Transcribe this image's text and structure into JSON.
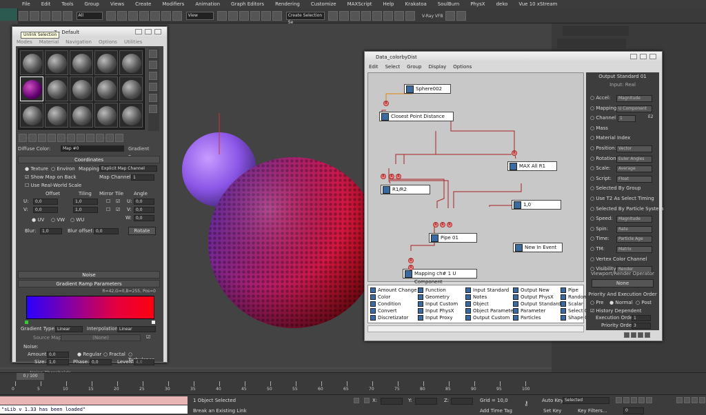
{
  "menubar": [
    "File",
    "Edit",
    "Tools",
    "Group",
    "Views",
    "Create",
    "Modifiers",
    "Animation",
    "Graph Editors",
    "Rendering",
    "Customize",
    "MAXScript",
    "Help",
    "Krakatoa",
    "SoulBurn",
    "PhysX",
    "deko",
    "Vue 10 xStream"
  ],
  "toolbar": {
    "filter": "All",
    "view": "View",
    "selection_set": "Create Selection Se",
    "vray_label": "V-Ray VFB"
  },
  "tooltip": "Unlink Selection",
  "material_editor": {
    "title": "7 - Default",
    "menu": [
      "Modes",
      "Material",
      "Navigation",
      "Options",
      "Utilities"
    ],
    "diffuse_label": "Diffuse Color:",
    "map_name": "Map #0",
    "map_type": "Gradient Ramp",
    "coordinates": {
      "title": "Coordinates",
      "texture": "Texture",
      "environ": "Environ",
      "mapping_label": "Mapping:",
      "mapping": "Explicit Map Channel",
      "show_map": "Show Map on Back",
      "map_channel_label": "Map Channel:",
      "map_channel": "1",
      "real_world": "Use Real-World Scale",
      "offset": "Offset",
      "tiling": "Tiling",
      "mirror_tile": "Mirror Tile",
      "angle": "Angle",
      "u": "U:",
      "v": "V:",
      "w": "W:",
      "u_offset": "0,0",
      "v_offset": "0,0",
      "u_tiling": "1,0",
      "v_tiling": "1,0",
      "u_angle": "0,0",
      "v_angle": "0,0",
      "w_angle": "0,0",
      "uv": "UV",
      "vw": "VW",
      "wu": "WU",
      "blur_label": "Blur:",
      "blur": "1,0",
      "blur_offset_label": "Blur offset:",
      "blur_offset": "0,0",
      "rotate": "Rotate"
    },
    "noise_rollout": "Noise",
    "gradient": {
      "title": "Gradient Ramp Parameters",
      "readout": "R=42,G=0,B=255, Pos=0",
      "type_label": "Gradient Type:",
      "type": "Linear",
      "interp_label": "Interpolation:",
      "interp": "Linear",
      "source_label": "Source Map:",
      "source": "(None)",
      "noise_label": "Noise:",
      "amount_label": "Amount:",
      "amount": "0,0",
      "regular": "Regular",
      "fractal": "Fractal",
      "turbulence": "Turbulence",
      "size_label": "Size:",
      "size": "1,0",
      "phase_label": "Phase:",
      "phase": "0,0",
      "levels_label": "Levels:",
      "levels": "4,0",
      "noise_thresholds": "Noise Thresholds"
    }
  },
  "data_editor": {
    "title": "Data_colorbyDist",
    "menu": [
      "Edit",
      "Select",
      "Group",
      "Display",
      "Options"
    ],
    "nodes": [
      "Sphere002",
      "Closest Point Distance",
      "MAX All R1",
      "R1/R2",
      "1,0",
      "Pipe 01",
      "New In Event",
      "Mapping ch# 1 U Component"
    ],
    "pins": [
      "R",
      "R",
      "R",
      "R",
      "R",
      "R",
      "R",
      "R",
      "R",
      "R"
    ],
    "palette": [
      [
        "Amount Change",
        "Color",
        "Condition",
        "Convert",
        "Discretizator"
      ],
      [
        "Function",
        "Geometry",
        "Input Custom",
        "Input PhysX",
        "Input Proxy"
      ],
      [
        "Input Standard",
        "Notes",
        "Object",
        "Object Parameter",
        "Output Custom"
      ],
      [
        "Output New",
        "Output PhysX",
        "Output Standard",
        "Parameter",
        "Particles"
      ],
      [
        "Pipe",
        "Random",
        "Scalar",
        "Select Obj",
        "Shape Co"
      ]
    ],
    "params": {
      "title": "Output Standard 01",
      "input": "Input: Real",
      "rows": [
        [
          "Accel:",
          "Magnitude"
        ],
        [
          "Mapping:",
          "U Component"
        ],
        [
          "Channel #",
          "1"
        ],
        [
          "Mass",
          ""
        ],
        [
          "Material Index",
          ""
        ],
        [
          "Position:",
          "Vector"
        ],
        [
          "Rotation:",
          "Euler Angles"
        ],
        [
          "Scale:",
          "Average"
        ],
        [
          "Script:",
          "Float"
        ],
        [
          "Selected By Group",
          ""
        ],
        [
          "Use T2 As Select Timing",
          ""
        ],
        [
          "Selected By Particle System",
          ""
        ],
        [
          "Speed:",
          "Magnitude"
        ],
        [
          "Spin:",
          "Rate"
        ],
        [
          "Time:",
          "Particle Age"
        ],
        [
          "TM:",
          "Matrix"
        ],
        [
          "Vertex Color Channel",
          ""
        ],
        [
          "Visibility:",
          "Render"
        ]
      ],
      "e2": "E2",
      "viewport_op": "Viewport/Render Operator",
      "viewport_none": "None",
      "priority": "Priority And Execution Order",
      "pre": "Pre",
      "normal": "Normal",
      "post": "Post",
      "history": "History Dependent",
      "exec_label": "Execution Order:",
      "exec": "1",
      "prio_label": "Priority Order:",
      "prio": "3"
    }
  },
  "timeline": {
    "frame": "0 / 100",
    "ticks": [
      "0",
      "5",
      "10",
      "15",
      "20",
      "25",
      "30",
      "35",
      "40",
      "45",
      "50",
      "55",
      "60",
      "65",
      "70",
      "75",
      "80",
      "85",
      "90",
      "95",
      "100"
    ]
  },
  "status": {
    "script_out": "\"sLib v 1.33 has been loaded\"",
    "selected": "1 Object Selected",
    "hint": "Break an Existing Link",
    "x": "X:",
    "y": "Y:",
    "z": "Z:",
    "grid": "Grid = 10,0",
    "add_time_tag": "Add Time Tag",
    "auto_key": "Auto Key",
    "set_key": "Set Key",
    "key_mode": "Selected",
    "key_filters": "Key Filters...",
    "frame": "0"
  }
}
